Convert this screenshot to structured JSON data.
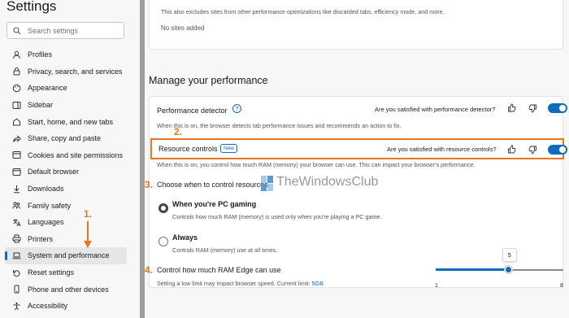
{
  "sidebar": {
    "title": "Settings",
    "search_placeholder": "Search settings",
    "items": [
      {
        "label": "Profiles"
      },
      {
        "label": "Privacy, search, and services"
      },
      {
        "label": "Appearance"
      },
      {
        "label": "Sidebar"
      },
      {
        "label": "Start, home, and new tabs"
      },
      {
        "label": "Share, copy and paste"
      },
      {
        "label": "Cookies and site permissions"
      },
      {
        "label": "Default browser"
      },
      {
        "label": "Downloads"
      },
      {
        "label": "Family safety"
      },
      {
        "label": "Languages"
      },
      {
        "label": "Printers"
      },
      {
        "label": "System and performance"
      },
      {
        "label": "Reset settings"
      },
      {
        "label": "Phone and other devices"
      },
      {
        "label": "Accessibility"
      }
    ]
  },
  "top_card": {
    "description": "This also excludes sites from other performance optimizations like discarded tabs, efficiency mode, and more.",
    "empty_text": "No sites added"
  },
  "section_title": "Manage your performance",
  "performance_detector": {
    "label": "Performance detector",
    "question": "Are you satisfied with performance detector?",
    "description": "When this is on, the browser detects tab performance issues and recommends an action to fix."
  },
  "resource_controls": {
    "label": "Resource controls",
    "badge": "New",
    "question": "Are you satisfied with resource controls?",
    "description": "When this is on, you control how much RAM (memory) your browser can use. This can impact your browser's performance."
  },
  "when_control": {
    "label": "Choose when to control resources",
    "watermark": "TheWindowsClub",
    "options": [
      {
        "label": "When you're PC gaming",
        "description": "Controls how much RAM (memory) is used only when you're playing a PC game.",
        "selected": true
      },
      {
        "label": "Always",
        "description": "Controls RAM (memory) use at all times.",
        "selected": false
      }
    ]
  },
  "ram_control": {
    "label": "Control how much RAM Edge can use",
    "description": "Setting a low limit may impact browser speed. Current limit:",
    "limit": "5GB",
    "slider": {
      "min": 1,
      "max": 8,
      "value": 5,
      "value_label": "5",
      "min_label": "1",
      "max_label": "8"
    }
  },
  "annotations": {
    "a1": "1.",
    "a2": "2.",
    "a3": "3.",
    "a4": "4."
  },
  "colors": {
    "accent": "#0f6cbd",
    "annotation": "#e87722"
  }
}
